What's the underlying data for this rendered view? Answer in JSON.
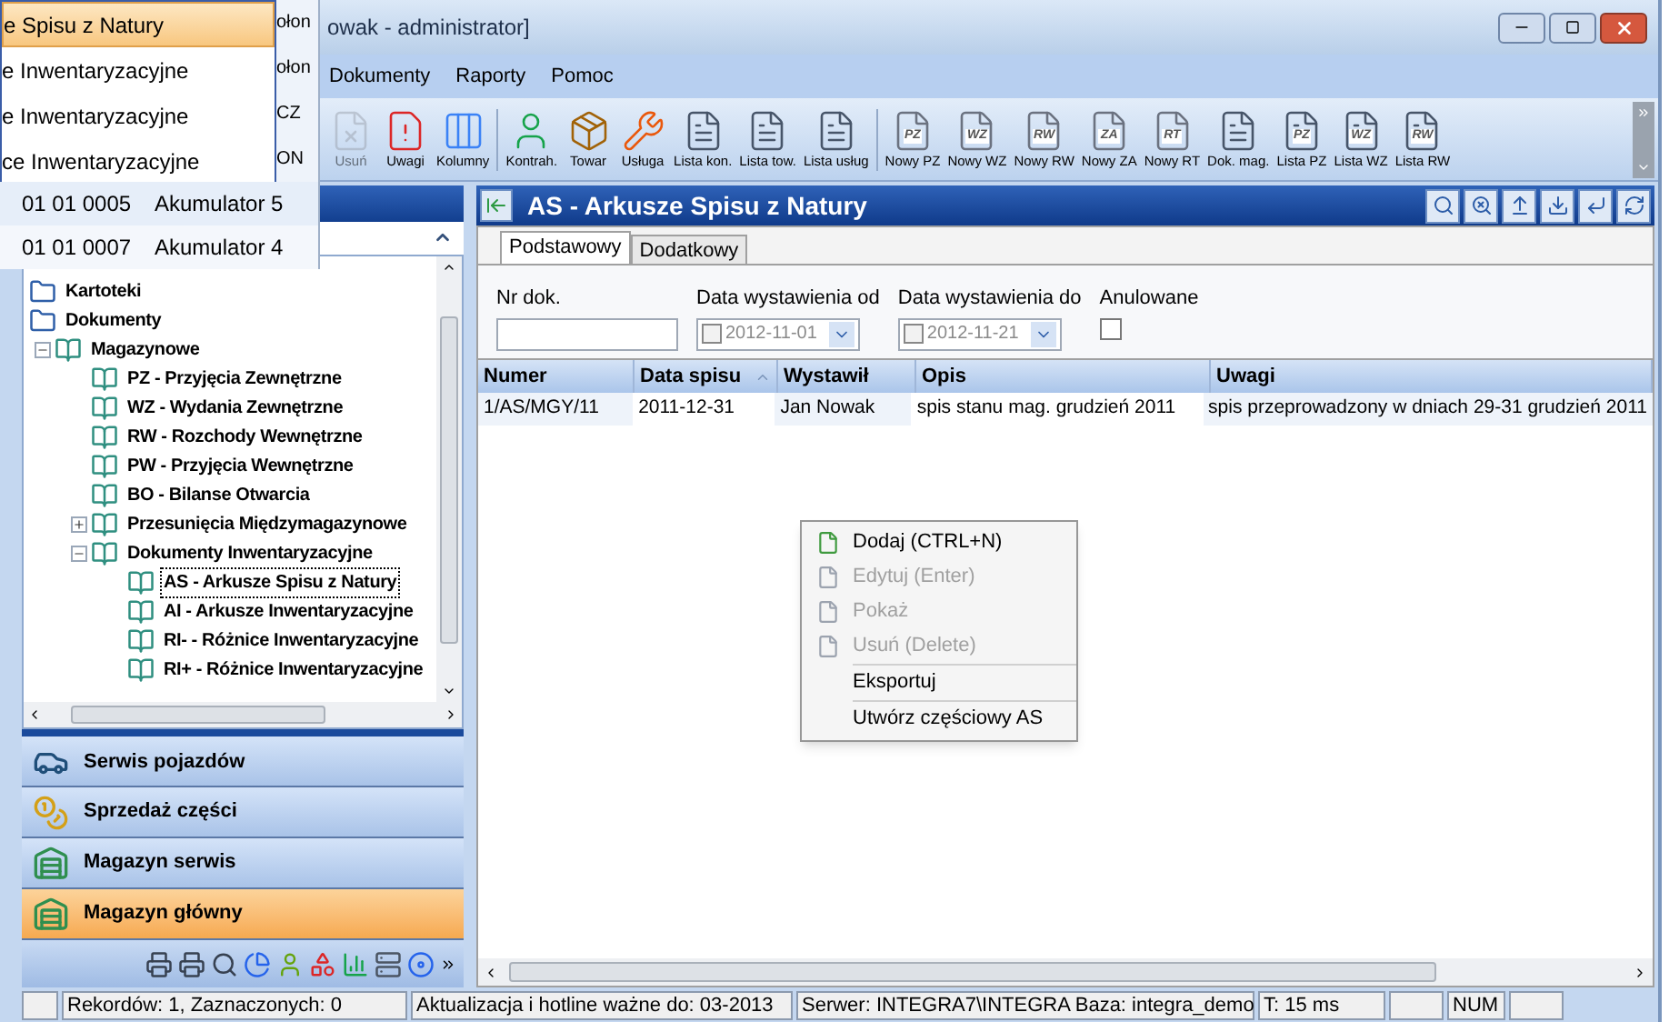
{
  "window": {
    "title": "owak - administrator]"
  },
  "menu": [
    {
      "label": "Dokumenty"
    },
    {
      "label": "Raporty"
    },
    {
      "label": "Pomoc"
    }
  ],
  "toolbar": [
    {
      "label": "Usuń",
      "kind": "delete",
      "disabled": true
    },
    {
      "label": "Uwagi",
      "kind": "notes",
      "disabled": false
    },
    {
      "label": "Kolumny",
      "kind": "columns",
      "disabled": false,
      "separator_after": true
    },
    {
      "label": "Kontrah.",
      "kind": "person",
      "disabled": false
    },
    {
      "label": "Towar",
      "kind": "box",
      "disabled": false
    },
    {
      "label": "Usługa",
      "kind": "tools",
      "disabled": false
    },
    {
      "label": "Lista kon.",
      "kind": "list",
      "disabled": false
    },
    {
      "label": "Lista tow.",
      "kind": "list",
      "disabled": false
    },
    {
      "label": "Lista usług",
      "kind": "list",
      "disabled": false,
      "separator_after": true
    },
    {
      "label": "Nowy PZ",
      "kind": "doc",
      "icon_text": "PZ",
      "disabled": false
    },
    {
      "label": "Nowy WZ",
      "kind": "doc",
      "icon_text": "WZ",
      "disabled": false
    },
    {
      "label": "Nowy RW",
      "kind": "doc",
      "icon_text": "RW",
      "disabled": false
    },
    {
      "label": "Nowy ZA",
      "kind": "doc",
      "icon_text": "ZA",
      "disabled": false
    },
    {
      "label": "Nowy RT",
      "kind": "doc",
      "icon_text": "RT",
      "disabled": false
    },
    {
      "label": "Dok. mag.",
      "kind": "list",
      "disabled": false
    },
    {
      "label": "Lista PZ",
      "kind": "list",
      "icon_text": "PZ",
      "disabled": false
    },
    {
      "label": "Lista WZ",
      "kind": "list",
      "icon_text": "WZ",
      "disabled": false
    },
    {
      "label": "Lista RW",
      "kind": "list",
      "icon_text": "RW",
      "disabled": false
    }
  ],
  "tree": [
    {
      "label": "Kartoteki",
      "kind": "folder"
    },
    {
      "label": "Dokumenty",
      "kind": "folder",
      "children": [
        {
          "label": "Magazynowe",
          "kind": "book",
          "expanded": true,
          "children": [
            {
              "label": "PZ - Przyjęcia Zewnętrzne",
              "kind": "book",
              "selected": false
            },
            {
              "label": "WZ - Wydania Zewnętrzne",
              "kind": "book",
              "selected": false
            },
            {
              "label": "RW - Rozchody Wewnętrzne",
              "kind": "book",
              "selected": false
            },
            {
              "label": "PW - Przyjęcia Wewnętrzne",
              "kind": "book",
              "selected": false
            },
            {
              "label": "BO - Bilanse Otwarcia",
              "kind": "book",
              "selected": false
            },
            {
              "label": "Przesunięcia Międzymagazynowe",
              "kind": "book",
              "expanded": false,
              "has_children": true
            },
            {
              "label": "Dokumenty Inwentaryzacyjne",
              "kind": "book",
              "expanded": true,
              "children": [
                {
                  "label": "AS - Arkusze Spisu z Natury",
                  "kind": "book",
                  "selected": true
                },
                {
                  "label": "AI - Arkusze Inwentaryzacyjne",
                  "kind": "book",
                  "selected": false
                },
                {
                  "label": "RI- - Różnice Inwentaryzacyjne",
                  "kind": "book",
                  "selected": false
                },
                {
                  "label": "RI+ - Różnice Inwentaryzacyjne",
                  "kind": "book",
                  "selected": false
                }
              ]
            }
          ]
        }
      ]
    }
  ],
  "modules": [
    {
      "label": "Serwis pojazdów",
      "kind": "car",
      "selected": false
    },
    {
      "label": "Sprzedaż części",
      "kind": "coins",
      "selected": false
    },
    {
      "label": "Magazyn serwis",
      "kind": "warehouse",
      "selected": false
    },
    {
      "label": "Magazyn główny",
      "kind": "warehouse",
      "selected": true
    }
  ],
  "module_icons": [
    {
      "kind": "printer"
    },
    {
      "kind": "printer"
    },
    {
      "kind": "search"
    },
    {
      "kind": "chart"
    },
    {
      "kind": "person"
    },
    {
      "kind": "shapes"
    },
    {
      "kind": "bars"
    },
    {
      "kind": "server"
    },
    {
      "kind": "disc"
    }
  ],
  "panel": {
    "title": "AS - Arkusze Spisu z Natury",
    "tabs": [
      {
        "label": "Podstawowy",
        "selected": true
      },
      {
        "label": "Dodatkowy",
        "selected": false
      }
    ],
    "filters": {
      "nr_dok": {
        "label": "Nr dok."
      },
      "date_from": {
        "label": "Data wystawienia od",
        "value": "2012-11-01",
        "checked": false
      },
      "date_to": {
        "label": "Data wystawienia do",
        "value": "2012-11-21",
        "checked": false
      },
      "cancelled": {
        "label": "Anulowane",
        "checked": false
      }
    },
    "table": {
      "columns": [
        {
          "label": "Numer",
          "sorted": false
        },
        {
          "label": "Data spisu",
          "sorted": true
        },
        {
          "label": "Wystawił",
          "sorted": false
        },
        {
          "label": "Opis",
          "sorted": false
        },
        {
          "label": "Uwagi",
          "sorted": false
        }
      ],
      "rows": [
        [
          "1/AS/MGY/11",
          "2011-12-31",
          "Jan Nowak",
          "spis stanu mag. grudzień 2011",
          "spis przeprowadzony w dniach 29-31 grudzień 2011"
        ]
      ]
    }
  },
  "context_menu": [
    {
      "label": "Dodaj (CTRL+N)",
      "has_icon": true,
      "disabled": false
    },
    {
      "label": "Edytuj (Enter)",
      "has_icon": true,
      "disabled": true
    },
    {
      "label": "Pokaż",
      "has_icon": true,
      "disabled": true
    },
    {
      "label": "Usuń (Delete)",
      "has_icon": true,
      "disabled": true
    },
    {
      "label": "Eksportuj",
      "has_icon": false,
      "disabled": false,
      "separator_before": true
    },
    {
      "label": "Utwórz częściowy AS",
      "has_icon": false,
      "disabled": false,
      "separator_before": true
    }
  ],
  "overlay": {
    "dropdown": [
      {
        "label": "e Spisu z Natury",
        "selected": true
      },
      {
        "label": "e Inwentaryzacyjne",
        "selected": false
      },
      {
        "label": "e Inwentaryzacyjne",
        "selected": false
      },
      {
        "label": "ce Inwentaryzacyjne",
        "selected": false
      }
    ],
    "column_3": [
      "ołon",
      "ołon",
      "CZ",
      "ON"
    ],
    "rows": [
      [
        "01 01 0005",
        "Akumulator 5"
      ],
      [
        "01 01 0007",
        "Akumulator 4"
      ]
    ]
  },
  "status_bar": [
    "Rekordów: 1, Zaznaczonych: 0",
    "Aktualizacja i hotline ważne do: 03-2013",
    "Serwer: INTEGRA7\\INTEGRA  Baza: integra_demo",
    "T: 15 ms",
    "NUM"
  ]
}
